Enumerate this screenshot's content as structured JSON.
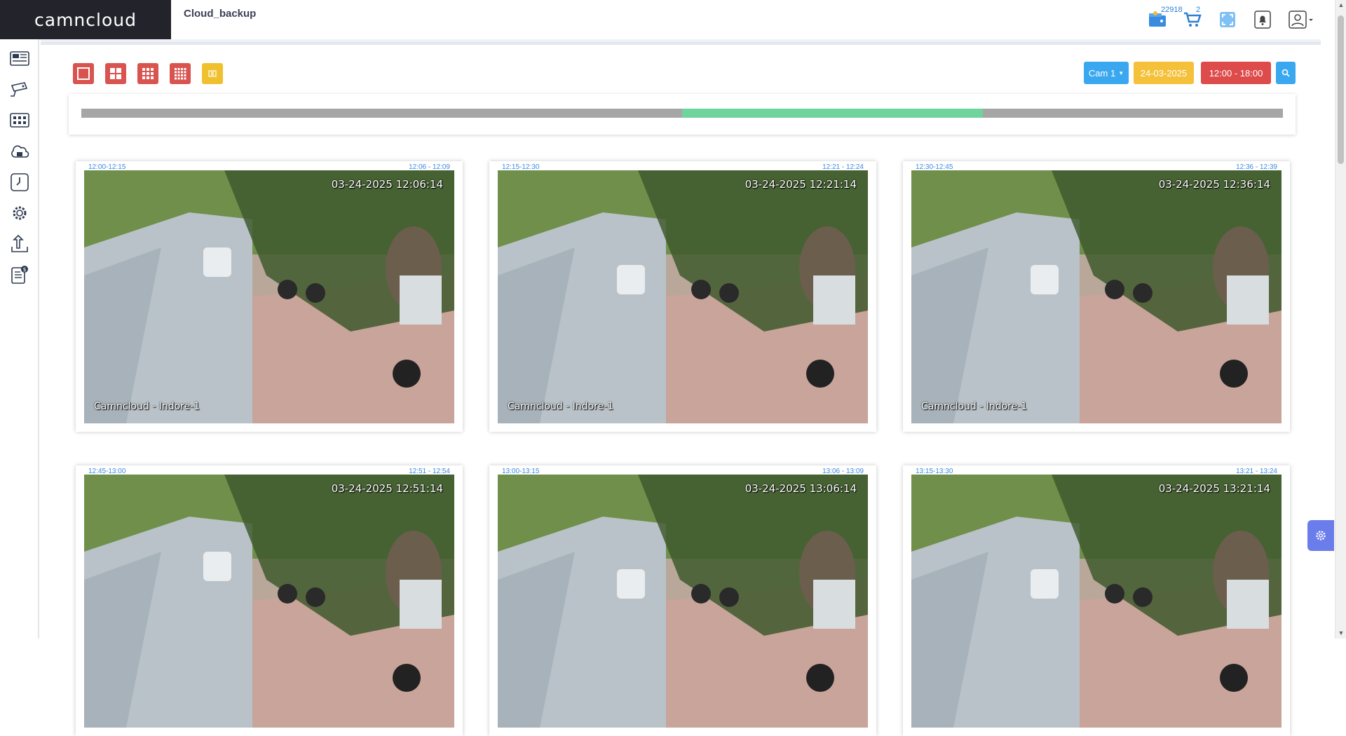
{
  "app": {
    "logo_text": "camncloud",
    "page_title": "Cloud_backup"
  },
  "header": {
    "wallet_count": "22918",
    "cart_count": "2",
    "icons": [
      "wallet-icon",
      "cart-icon",
      "fullscreen-icon",
      "notification-bell-icon",
      "user-profile-icon"
    ]
  },
  "sidebar": {
    "items": [
      {
        "name": "dashboard",
        "icon": "dashboard-icon"
      },
      {
        "name": "cameras",
        "icon": "cctv-camera-icon"
      },
      {
        "name": "live-grid",
        "icon": "grid-view-icon"
      },
      {
        "name": "cloud-storage",
        "icon": "cloud-home-icon"
      },
      {
        "name": "schedule",
        "icon": "clock-icon"
      },
      {
        "name": "settings",
        "icon": "gear-icon"
      },
      {
        "name": "upload",
        "icon": "upload-icon"
      },
      {
        "name": "billing",
        "icon": "invoice-icon"
      }
    ]
  },
  "toolbar": {
    "layouts": [
      {
        "name": "layout-1x1",
        "color": "#d9534f"
      },
      {
        "name": "layout-2x2",
        "color": "#d9534f"
      },
      {
        "name": "layout-3x3",
        "color": "#d9534f"
      },
      {
        "name": "layout-4x4",
        "color": "#d9534f"
      },
      {
        "name": "layout-custom",
        "color": "#f0c02e"
      }
    ],
    "camera_label": "Cam 1",
    "date_label": "24-03-2025",
    "time_label": "12:00 - 18:00",
    "colors": {
      "camera": "#3aa8f0",
      "date": "#f5c13a",
      "time": "#dd4b4b",
      "search": "#3aa8f0"
    }
  },
  "timeline": {
    "range_start": "12:00",
    "range_end": "18:00",
    "highlight_start_fraction": 0.5,
    "highlight_end_fraction": 0.75,
    "track_color": "#a6a6a6",
    "highlight_color": "#6fd49b"
  },
  "clips": [
    {
      "slot": "12:00-12:15",
      "range": "12:06 - 12:09",
      "stamp": "03-24-2025 12:06:14",
      "watermark": "Camncloud - Indore-1"
    },
    {
      "slot": "12:15-12:30",
      "range": "12:21 - 12:24",
      "stamp": "03-24-2025 12:21:14",
      "watermark": "Camncloud - Indore-1"
    },
    {
      "slot": "12:30-12:45",
      "range": "12:36 - 12:39",
      "stamp": "03-24-2025 12:36:14",
      "watermark": "Camncloud - Indore-1"
    },
    {
      "slot": "12:45-13:00",
      "range": "12:51 - 12:54",
      "stamp": "03-24-2025 12:51:14",
      "watermark": ""
    },
    {
      "slot": "13:00-13:15",
      "range": "13:06 - 13:09",
      "stamp": "03-24-2025 13:06:14",
      "watermark": ""
    },
    {
      "slot": "13:15-13:30",
      "range": "13:21 - 13:24",
      "stamp": "03-24-2025 13:21:14",
      "watermark": ""
    }
  ]
}
